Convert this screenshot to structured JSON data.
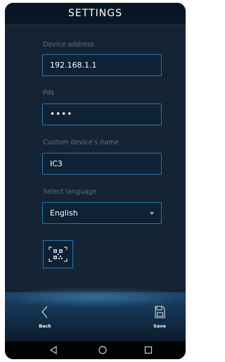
{
  "header": {
    "title": "SETTINGS"
  },
  "form": {
    "device_address": {
      "label": "Device address",
      "value": "192.168.1.1"
    },
    "pin": {
      "label": "PIN",
      "value": "••••"
    },
    "device_name": {
      "label": "Custom device's name",
      "value": "IC3"
    },
    "language": {
      "label": "Select language",
      "value": "English"
    }
  },
  "actions": {
    "back_label": "Back",
    "save_label": "Save"
  },
  "icons": {
    "qr": "qr-code-icon",
    "back": "chevron-left-icon",
    "save": "floppy-disk-icon",
    "nav_back": "triangle-back-icon",
    "nav_home": "circle-home-icon",
    "nav_recents": "square-recents-icon"
  },
  "colors": {
    "accent": "#2c77b0",
    "background": "#152435",
    "header": "#0b1624"
  }
}
